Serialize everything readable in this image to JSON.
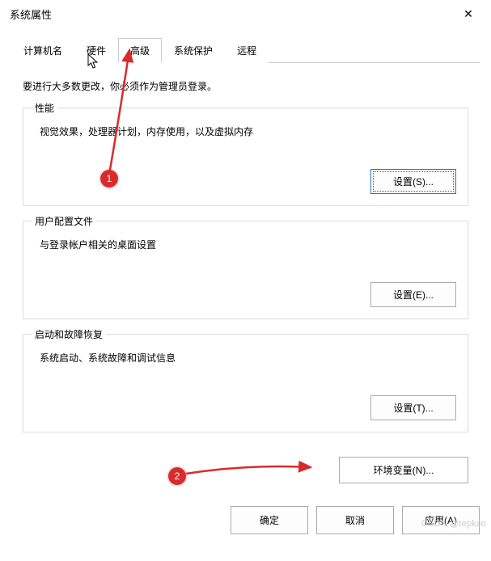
{
  "window": {
    "title": "系统属性",
    "close_glyph": "✕"
  },
  "tabs": {
    "t0": "计算机名",
    "t1": "硬件",
    "t2": "高级",
    "t3": "系统保护",
    "t4": "远程",
    "active_index": 2
  },
  "intro": "要进行大多数更改，你必须作为管理员登录。",
  "groups": {
    "performance": {
      "legend": "性能",
      "desc": "视觉效果，处理器计划，内存使用，以及虚拟内存",
      "btn": "设置(S)..."
    },
    "profiles": {
      "legend": "用户配置文件",
      "desc": "与登录帐户相关的桌面设置",
      "btn": "设置(E)..."
    },
    "startup": {
      "legend": "启动和故障恢复",
      "desc": "系统启动、系统故障和调试信息",
      "btn": "设置(T)..."
    }
  },
  "env_btn": "环境变量(N)...",
  "buttons": {
    "ok": "确定",
    "cancel": "取消",
    "apply": "应用(A)"
  },
  "annotations": {
    "badge1": "1",
    "badge2": "2"
  },
  "watermark": "CSDN @tepkco"
}
